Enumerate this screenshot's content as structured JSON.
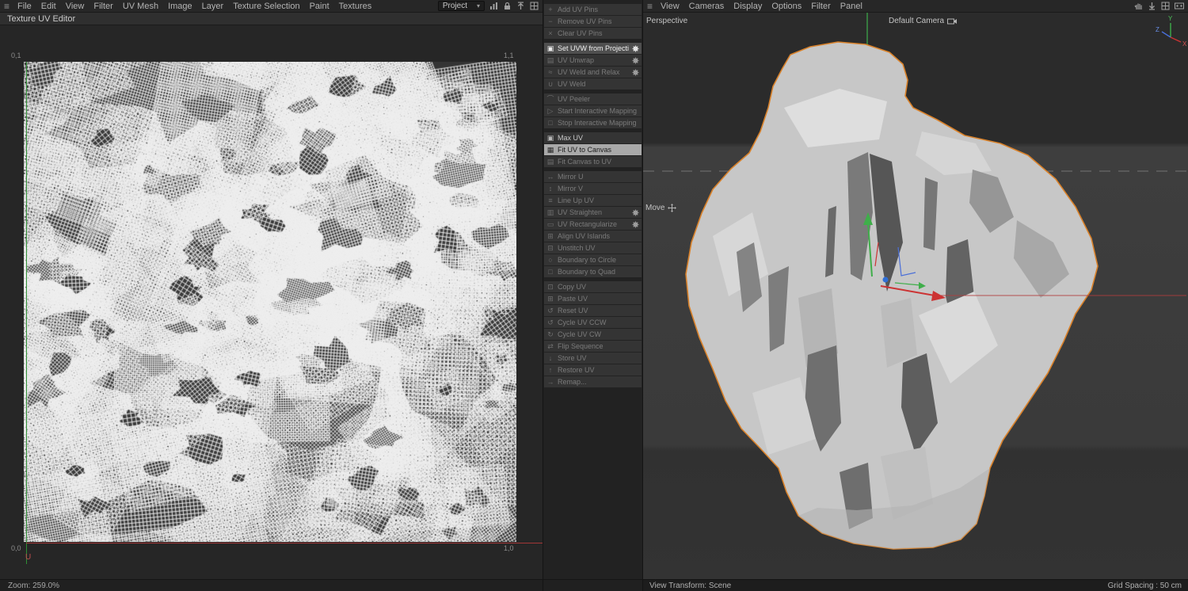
{
  "colors": {
    "selection_orange": "#d9822b",
    "axis_red": "#c03636",
    "axis_green": "#3fae4a",
    "axis_blue": "#3a6fd6",
    "bg_dark": "#262626"
  },
  "icons": {
    "hamburger": "≡",
    "dropdown_arrow": "▾",
    "stats": "bar-chart",
    "lock": "padlock",
    "snapshot": "arrow-up",
    "layout": "window-grid",
    "grab": "hand",
    "minimize": "arrow-down",
    "film": "film-strip",
    "camera": "camera",
    "move_tool": "move-cross",
    "gear": "cog"
  },
  "left": {
    "menu": [
      "File",
      "Edit",
      "View",
      "Filter",
      "UV Mesh",
      "Image",
      "Layer",
      "Texture Selection",
      "Paint",
      "Textures"
    ],
    "project_dropdown": "Project",
    "panel_title": "Texture UV Editor",
    "corners": {
      "tl": "0,1",
      "tr": "1,1",
      "bl": "0,0",
      "br": "1,0"
    },
    "u_axis_label": "U",
    "zoom_status": "Zoom: 259.0%"
  },
  "commands": {
    "items": [
      {
        "label": "Add UV Pins",
        "icon": "add-pin-icon",
        "glyph": "+",
        "state": "disabled",
        "gear": false,
        "sep_after": false
      },
      {
        "label": "Remove UV Pins",
        "icon": "remove-pin-icon",
        "glyph": "−",
        "state": "disabled",
        "gear": false,
        "sep_after": false
      },
      {
        "label": "Clear UV Pins",
        "icon": "clear-pin-icon",
        "glyph": "×",
        "state": "disabled",
        "gear": false,
        "sep_after": true
      },
      {
        "label": "Set UVW from Projection",
        "icon": "projection-icon",
        "glyph": "▣",
        "state": "highlight",
        "gear": true,
        "sep_after": false
      },
      {
        "label": "UV Unwrap",
        "icon": "unwrap-icon",
        "glyph": "▤",
        "state": "disabled",
        "gear": true,
        "sep_after": false
      },
      {
        "label": "UV Weld and Relax",
        "icon": "weld-relax-icon",
        "glyph": "≈",
        "state": "disabled",
        "gear": true,
        "sep_after": false
      },
      {
        "label": "UV Weld",
        "icon": "weld-icon",
        "glyph": "∪",
        "state": "disabled",
        "gear": false,
        "sep_after": true
      },
      {
        "label": "UV Peeler",
        "icon": "peeler-icon",
        "glyph": "⌒",
        "state": "disabled",
        "gear": false,
        "sep_after": false
      },
      {
        "label": "Start Interactive Mapping",
        "icon": "start-mapping-icon",
        "glyph": "▷",
        "state": "disabled",
        "gear": false,
        "sep_after": false
      },
      {
        "label": "Stop Interactive Mapping",
        "icon": "stop-mapping-icon",
        "glyph": "□",
        "state": "disabled",
        "gear": false,
        "sep_after": true
      },
      {
        "label": "Max UV",
        "icon": "max-uv-icon",
        "glyph": "▣",
        "state": "normal",
        "gear": false,
        "sep_after": false
      },
      {
        "label": "Fit UV to Canvas",
        "icon": "fit-uv-icon",
        "glyph": "▦",
        "state": "pressed",
        "gear": false,
        "sep_after": false
      },
      {
        "label": "Fit Canvas to UV",
        "icon": "fit-canvas-icon",
        "glyph": "▤",
        "state": "disabled",
        "gear": false,
        "sep_after": true
      },
      {
        "label": "Mirror U",
        "icon": "mirror-u-icon",
        "glyph": "↔",
        "state": "disabled",
        "gear": false,
        "sep_after": false
      },
      {
        "label": "Mirror V",
        "icon": "mirror-v-icon",
        "glyph": "↕",
        "state": "disabled",
        "gear": false,
        "sep_after": false
      },
      {
        "label": "Line Up UV",
        "icon": "lineup-icon",
        "glyph": "≡",
        "state": "disabled",
        "gear": false,
        "sep_after": false
      },
      {
        "label": "UV Straighten",
        "icon": "straighten-icon",
        "glyph": "▥",
        "state": "disabled",
        "gear": true,
        "sep_after": false
      },
      {
        "label": "UV Rectangularize",
        "icon": "rectangularize-icon",
        "glyph": "▭",
        "state": "disabled",
        "gear": true,
        "sep_after": false
      },
      {
        "label": "Align UV Islands",
        "icon": "align-islands-icon",
        "glyph": "⊞",
        "state": "disabled",
        "gear": false,
        "sep_after": false
      },
      {
        "label": "Unstitch UV",
        "icon": "unstitch-icon",
        "glyph": "⊟",
        "state": "disabled",
        "gear": false,
        "sep_after": false
      },
      {
        "label": "Boundary to Circle",
        "icon": "boundary-circle-icon",
        "glyph": "○",
        "state": "disabled",
        "gear": false,
        "sep_after": false
      },
      {
        "label": "Boundary to Quad",
        "icon": "boundary-quad-icon",
        "glyph": "□",
        "state": "disabled",
        "gear": false,
        "sep_after": true
      },
      {
        "label": "Copy UV",
        "icon": "copy-icon",
        "glyph": "⊡",
        "state": "disabled",
        "gear": false,
        "sep_after": false
      },
      {
        "label": "Paste UV",
        "icon": "paste-icon",
        "glyph": "⊞",
        "state": "disabled",
        "gear": false,
        "sep_after": false
      },
      {
        "label": "Reset UV",
        "icon": "reset-icon",
        "glyph": "↺",
        "state": "disabled",
        "gear": false,
        "sep_after": false
      },
      {
        "label": "Cycle UV CCW",
        "icon": "cycle-ccw-icon",
        "glyph": "↺",
        "state": "disabled",
        "gear": false,
        "sep_after": false
      },
      {
        "label": "Cycle UV CW",
        "icon": "cycle-cw-icon",
        "glyph": "↻",
        "state": "disabled",
        "gear": false,
        "sep_after": false
      },
      {
        "label": "Flip Sequence",
        "icon": "flip-sequence-icon",
        "glyph": "⇄",
        "state": "disabled",
        "gear": false,
        "sep_after": false
      },
      {
        "label": "Store UV",
        "icon": "store-icon",
        "glyph": "↓",
        "state": "disabled",
        "gear": false,
        "sep_after": false
      },
      {
        "label": "Restore UV",
        "icon": "restore-icon",
        "glyph": "↑",
        "state": "disabled",
        "gear": false,
        "sep_after": false
      },
      {
        "label": "Remap...",
        "icon": "remap-icon",
        "glyph": "→",
        "state": "disabled",
        "gear": false,
        "sep_after": false
      }
    ]
  },
  "right": {
    "menu": [
      "View",
      "Cameras",
      "Display",
      "Options",
      "Filter",
      "Panel"
    ],
    "view_label": "Perspective",
    "camera_label": "Default Camera",
    "tool_label": "Move",
    "status_left": "View Transform: Scene",
    "status_right": "Grid Spacing : 50 cm",
    "axis": {
      "x": "X",
      "y": "Y",
      "z": "Z"
    }
  }
}
